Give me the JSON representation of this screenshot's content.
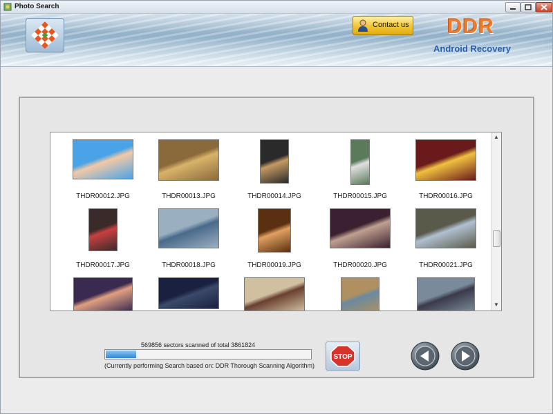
{
  "window": {
    "title": "Photo Search"
  },
  "header": {
    "contact_label": "Contact us",
    "brand": "DDR",
    "brand_sub": "Android Recovery",
    "brand_color": "#f07a28",
    "sub_color": "#2c5fa8"
  },
  "gallery": {
    "items": [
      {
        "name": "THDR00012.JPG"
      },
      {
        "name": "THDR00013.JPG"
      },
      {
        "name": "THDR00014.JPG"
      },
      {
        "name": "THDR00015.JPG"
      },
      {
        "name": "THDR00016.JPG"
      },
      {
        "name": "THDR00017.JPG"
      },
      {
        "name": "THDR00018.JPG"
      },
      {
        "name": "THDR00019.JPG"
      },
      {
        "name": "THDR00020.JPG"
      },
      {
        "name": "THDR00021.JPG"
      },
      {
        "name": ""
      },
      {
        "name": ""
      },
      {
        "name": ""
      },
      {
        "name": ""
      },
      {
        "name": ""
      }
    ]
  },
  "scan": {
    "status": "569856 sectors scanned of total 3861824",
    "sectors_scanned": 569856,
    "sectors_total": 3861824,
    "progress_fraction": 0.1476,
    "algorithm_note": "(Currently performing Search based on:  DDR Thorough Scanning Algorithm)"
  },
  "controls": {
    "stop_label": "STOP",
    "stop_color": "#d5342b",
    "prev_icon": "arrow-left-icon",
    "next_icon": "arrow-right-icon"
  }
}
